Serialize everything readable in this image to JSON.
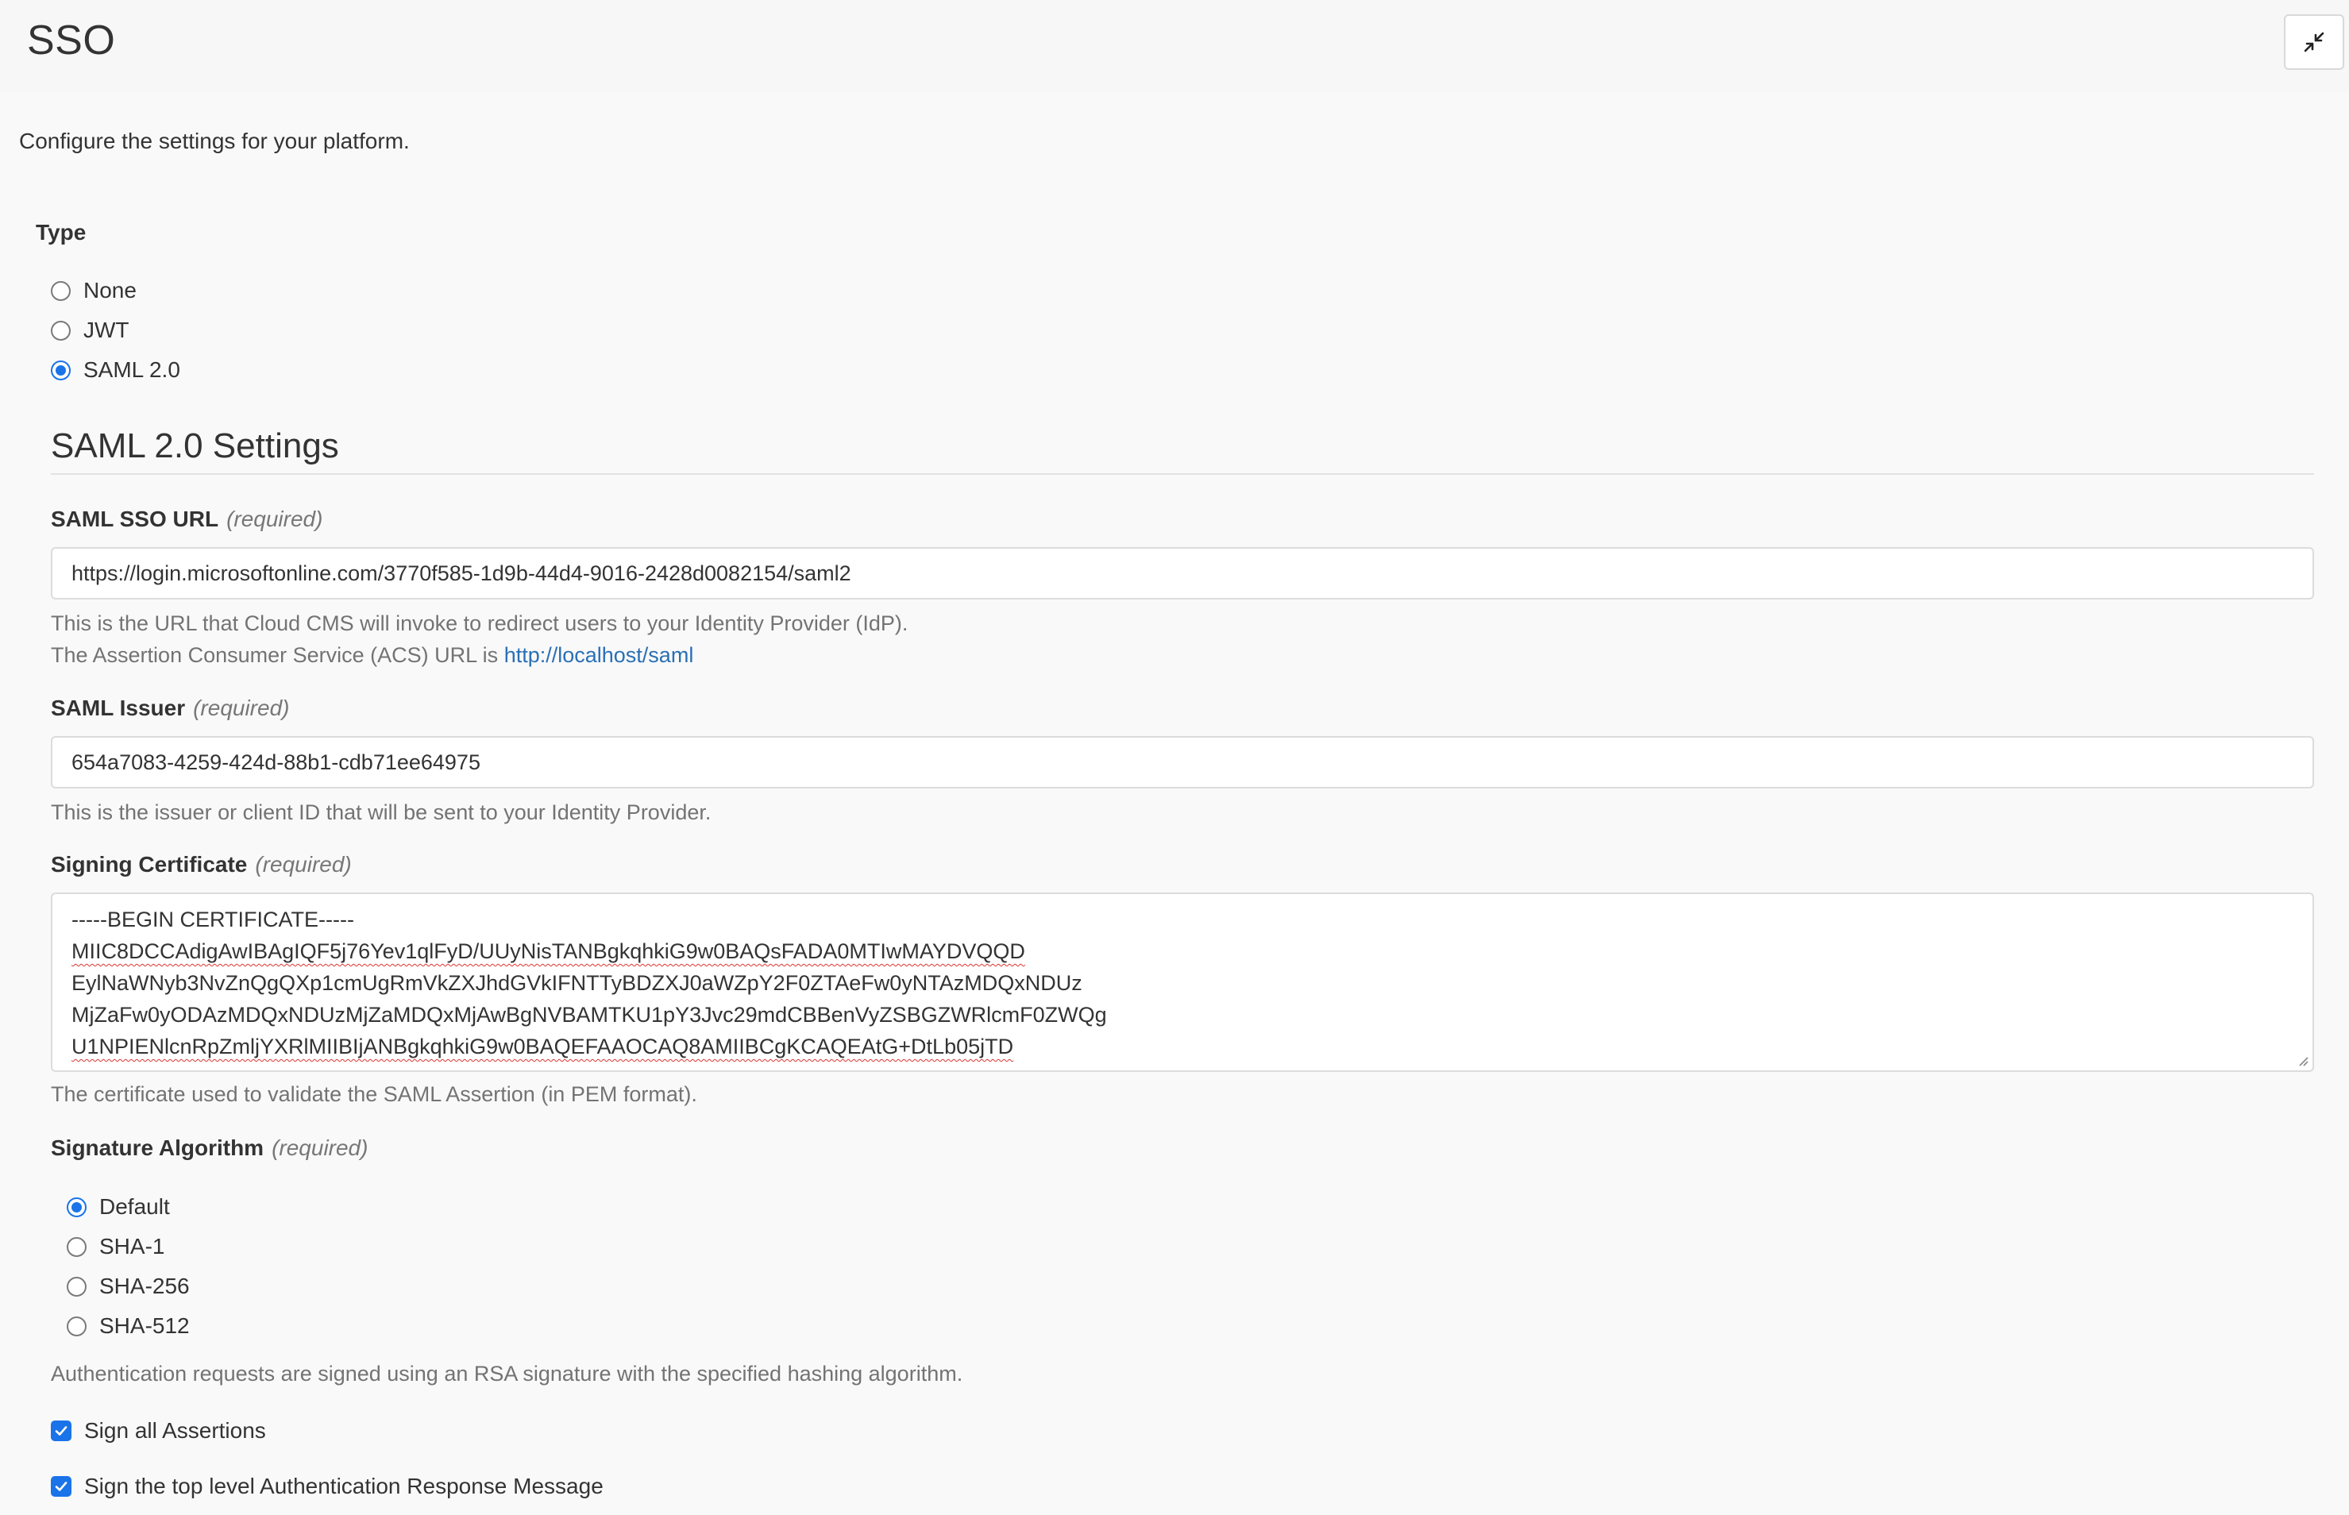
{
  "header": {
    "title": "SSO",
    "collapse_icon": "collapse-arrows-icon"
  },
  "intro": "Configure the settings for your platform.",
  "type": {
    "label": "Type",
    "options": [
      "None",
      "JWT",
      "SAML 2.0"
    ],
    "selected": "SAML 2.0"
  },
  "saml": {
    "section_title": "SAML 2.0 Settings",
    "required_text": "(required)",
    "sso_url": {
      "label": "SAML SSO URL",
      "value": "https://login.microsoftonline.com/3770f585-1d9b-44d4-9016-2428d0082154/saml2",
      "help_line1": "This is the URL that Cloud CMS will invoke to redirect users to your Identity Provider (IdP).",
      "help_line2": "The Assertion Consumer Service (ACS) URL is",
      "acs_link": "http://localhost/saml"
    },
    "issuer": {
      "label": "SAML Issuer",
      "value": "654a7083-4259-424d-88b1-cdb71ee64975",
      "help": "This is the issuer or client ID that will be sent to your Identity Provider."
    },
    "certificate": {
      "label": "Signing Certificate",
      "lines": [
        "-----BEGIN CERTIFICATE-----",
        "MIIC8DCCAdigAwIBAgIQF5j76Yev1qlFyD/UUyNisTANBgkqhkiG9w0BAQsFADA0MTIwMAYDVQQD",
        "EylNaWNyb3NvZnQgQXp1cmUgRmVkZXJhdGVkIFNTTyBDZXJ0aWZpY2F0ZTAeFw0yNTAzMDQxNDUz",
        "MjZaFw0yODAzMDQxNDUzMjZaMDQxMjAwBgNVBAMTKU1pY3Jvc29mdCBBenVyZSBGZWRlcmF0ZWQg",
        "U1NPIENlcnRpZmljYXRlMIIBIjANBgkqhkiG9w0BAQEFAAOCAQ8AMIIBCgKCAQEAtG+DtLb05jTD"
      ],
      "help": "The certificate used to validate the SAML Assertion (in PEM format)."
    },
    "signature_algorithm": {
      "label": "Signature Algorithm",
      "options": [
        "Default",
        "SHA-1",
        "SHA-256",
        "SHA-512"
      ],
      "selected": "Default",
      "help": "Authentication requests are signed using an RSA signature with the specified hashing algorithm."
    },
    "checkboxes": [
      {
        "label": "Sign all Assertions",
        "checked": true
      },
      {
        "label": "Sign the top level Authentication Response Message",
        "checked": true
      }
    ]
  },
  "colors": {
    "accent": "#1a73e8",
    "link": "#2a6fb5",
    "help_text": "#737373"
  }
}
